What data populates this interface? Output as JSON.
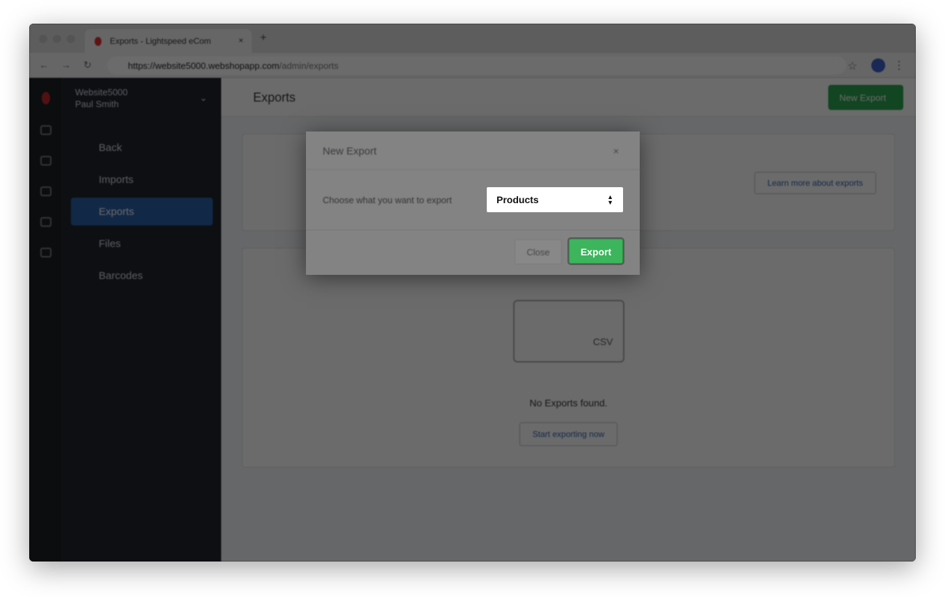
{
  "browser": {
    "tab_title": "Exports - Lightspeed eCom",
    "url_host": "https://website5000.webshopapp.com",
    "url_path": "/admin/exports"
  },
  "sidebar": {
    "store_name": "Website5000",
    "user_name": "Paul Smith",
    "items": [
      {
        "label": "Back"
      },
      {
        "label": "Imports"
      },
      {
        "label": "Exports"
      },
      {
        "label": "Files"
      },
      {
        "label": "Barcodes"
      }
    ]
  },
  "header": {
    "title": "Exports",
    "new_export_label": "New Export"
  },
  "info_card": {
    "learn_more_label": "Learn more about exports"
  },
  "empty_state": {
    "csv_label": "CSV",
    "message": "No Exports found.",
    "start_label": "Start exporting now"
  },
  "modal": {
    "title": "New Export",
    "close_icon": "×",
    "label": "Choose what you want to export",
    "select_value": "Products",
    "close_label": "Close",
    "export_label": "Export"
  },
  "colors": {
    "accent_green": "#3cb55d",
    "active_blue": "#2c5fa8"
  }
}
